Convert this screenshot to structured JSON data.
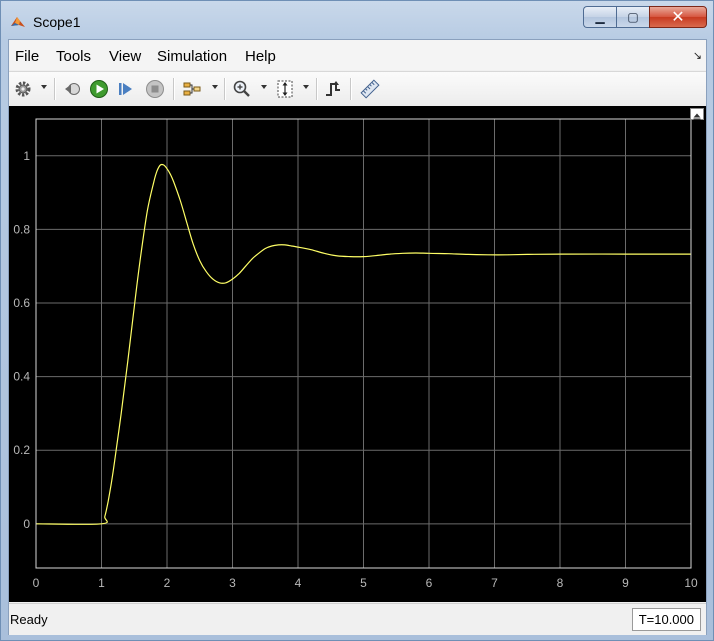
{
  "window": {
    "title": "Scope1",
    "minimize_symbol": "▁",
    "maximize_symbol": "▢",
    "close_symbol": "✕"
  },
  "menu": {
    "items": [
      "File",
      "Tools",
      "View",
      "Simulation",
      "Help"
    ],
    "overflow_symbol": "↘"
  },
  "toolbar": {
    "icons": [
      "gear-icon",
      "step-back-icon",
      "run-icon",
      "step-forward-icon",
      "stop-icon",
      "signal-selector-icon",
      "zoom-in-icon",
      "scale-axes-icon",
      "triggers-icon",
      "measurements-icon"
    ]
  },
  "colors": {
    "plot_background": "#000000",
    "grid": "#6b6b6b",
    "trace": "#ffff66",
    "tick_label": "#b8b8b8",
    "axes_border": "#d8d8d8"
  },
  "status": {
    "text": "Ready",
    "time": "T=10.000"
  },
  "chart_data": {
    "type": "line",
    "title": "",
    "xlabel": "",
    "ylabel": "",
    "xlim": [
      0,
      10
    ],
    "ylim": [
      -0.12,
      1.1
    ],
    "grid": true,
    "xticks": [
      0,
      1,
      2,
      3,
      4,
      5,
      6,
      7,
      8,
      9,
      10
    ],
    "yticks": [
      0,
      0.2,
      0.4,
      0.6,
      0.8,
      1
    ],
    "xtick_labels": [
      "0",
      "1",
      "2",
      "3",
      "4",
      "5",
      "6",
      "7",
      "8",
      "9",
      "10"
    ],
    "ytick_labels": [
      "0",
      "0.2",
      "0.4",
      "0.6",
      "0.8",
      "1"
    ],
    "series": [
      {
        "x": [
          0,
          1.0,
          1.05,
          1.1,
          1.15,
          1.2,
          1.3,
          1.4,
          1.5,
          1.6,
          1.7,
          1.8,
          1.85,
          1.9,
          1.95,
          2.0,
          2.05,
          2.1,
          2.2,
          2.3,
          2.4,
          2.5,
          2.6,
          2.7,
          2.8,
          2.9,
          3.0,
          3.1,
          3.2,
          3.3,
          3.4,
          3.5,
          3.6,
          3.7,
          3.8,
          3.9,
          4.0,
          4.2,
          4.4,
          4.6,
          4.8,
          5.0,
          5.2,
          5.4,
          5.6,
          5.8,
          6.0,
          6.3,
          6.6,
          6.9,
          7.2,
          7.5,
          8.0,
          9.0,
          10.0
        ],
        "y": [
          0,
          0,
          0.02,
          0.06,
          0.11,
          0.17,
          0.3,
          0.44,
          0.59,
          0.73,
          0.85,
          0.93,
          0.96,
          0.975,
          0.975,
          0.965,
          0.95,
          0.93,
          0.88,
          0.82,
          0.76,
          0.715,
          0.685,
          0.665,
          0.655,
          0.655,
          0.665,
          0.68,
          0.7,
          0.72,
          0.735,
          0.748,
          0.755,
          0.758,
          0.758,
          0.755,
          0.752,
          0.745,
          0.735,
          0.728,
          0.726,
          0.726,
          0.729,
          0.733,
          0.735,
          0.736,
          0.735,
          0.734,
          0.732,
          0.731,
          0.731,
          0.732,
          0.733,
          0.733,
          0.733
        ]
      }
    ]
  }
}
